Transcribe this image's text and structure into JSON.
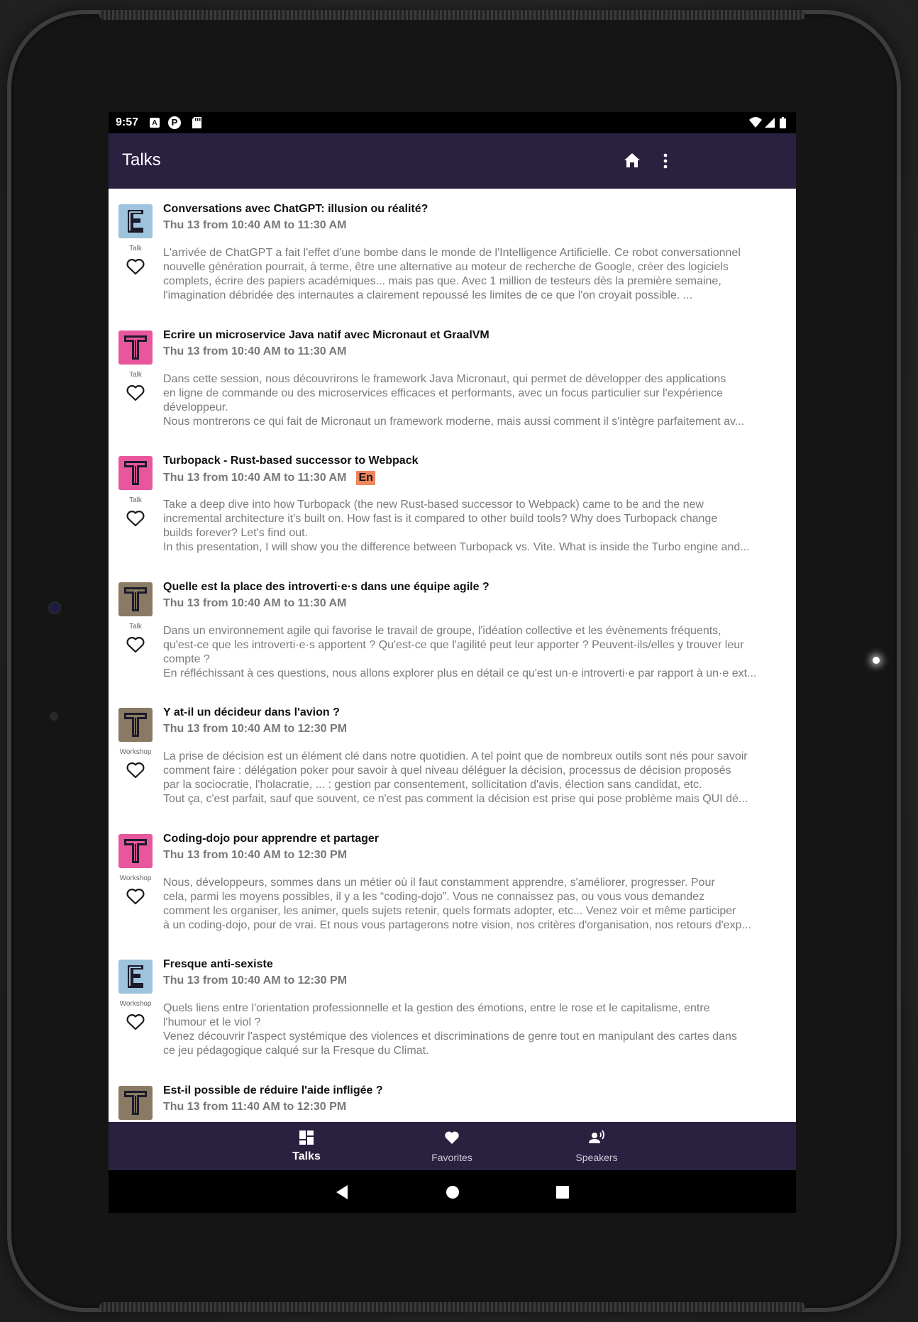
{
  "status_bar": {
    "time": "9:57",
    "a_icon": "A",
    "p_icon": "P"
  },
  "app_bar": {
    "title": "Talks"
  },
  "talks": [
    {
      "title": "Conversations avec ChatGPT: illusion ou réalité?",
      "time": "Thu 13 from 10:40 AM to 11:30 AM",
      "type": "Talk",
      "badge": "",
      "logo": "E",
      "logo_color": "#9ec3dc",
      "desc": [
        "L'arrivée de ChatGPT a fait l'effet d'une bombe dans le monde de l'Intelligence Artificielle. Ce robot conversationnel",
        "nouvelle génération pourrait, à terme, être une alternative au moteur de recherche de Google, créer des logiciels",
        "complets,  écrire des papiers académiques... mais pas que. Avec 1 million de testeurs dès la première semaine,",
        "l'imagination débridée des internautes a clairement repoussé les limites de ce que l'on croyait possible. ..."
      ]
    },
    {
      "title": "Ecrire un microservice Java natif avec Micronaut et GraalVM",
      "time": "Thu 13 from 10:40 AM to 11:30 AM",
      "type": "Talk",
      "badge": "",
      "logo": "T",
      "logo_color": "#e8569e",
      "desc": [
        "Dans cette session, nous découvrirons le framework Java Micronaut, qui permet de développer des applications",
        "en ligne de commande ou des microservices efficaces et performants, avec un focus particulier sur l'expérience",
        "développeur.",
        "Nous montrerons ce qui fait de Micronaut un framework moderne, mais aussi comment il s'intègre parfaitement av..."
      ]
    },
    {
      "title": "Turbopack - Rust-based successor to Webpack",
      "time": "Thu 13 from 10:40 AM to 11:30 AM",
      "type": "Talk",
      "badge": "En",
      "logo": "T",
      "logo_color": "#e8569e",
      "desc": [
        "Take a deep dive into how Turbopack (the new Rust-based successor to Webpack) came to be and the new",
        "incremental architecture it's built on. How fast is it compared to other build tools? Why does Turbopack change",
        "builds forever? Let's find out.",
        "In this presentation, I will show you the difference between Turbopack vs. Vite. What is inside the Turbo engine and..."
      ]
    },
    {
      "title": "Quelle est la place des introverti·e·s dans une équipe agile ?",
      "time": "Thu 13 from 10:40 AM to 11:30 AM",
      "type": "Talk",
      "badge": "",
      "logo": "T",
      "logo_color": "#8a7a64",
      "desc": [
        "Dans un environnement agile qui favorise le travail de groupe, l'idéation collective et les évènements fréquents,",
        "qu'est-ce que les introverti·e·s apportent ? Qu'est-ce que l'agilité peut leur apporter ? Peuvent-ils/elles y trouver leur",
        "compte ?",
        "En réfléchissant à ces questions, nous allons explorer plus en détail ce qu'est un·e introverti·e par rapport à un·e ext..."
      ]
    },
    {
      "title": "Y at-il un décideur dans l'avion ?",
      "time": "Thu 13 from 10:40 AM to 12:30 PM",
      "type": "Workshop",
      "badge": "",
      "logo": "T",
      "logo_color": "#8a7a64",
      "desc": [
        "La prise de décision est un élément clé dans notre quotidien. A tel point que de nombreux outils sont nés pour savoir",
        "comment faire : délégation poker pour savoir à quel niveau déléguer la décision, processus de décision proposés",
        "par la sociocratie, l'holacratie, ... : gestion par consentement, sollicitation d'avis, élection sans candidat, etc.",
        "Tout ça, c'est parfait, sauf que souvent, ce n'est pas comment la décision est prise qui pose problème mais QUI dé..."
      ]
    },
    {
      "title": "Coding-dojo pour apprendre et partager",
      "time": "Thu 13 from 10:40 AM to 12:30 PM",
      "type": "Workshop",
      "badge": "",
      "logo": "T",
      "logo_color": "#e8569e",
      "desc": [
        "Nous, développeurs, sommes dans un métier où il faut constamment apprendre, s'améliorer, progresser. Pour",
        "cela, parmi les moyens possibles, il y a les “coding-dojo”. Vous ne connaissez pas, ou vous vous demandez",
        "comment les organiser, les animer, quels sujets retenir, quels formats adopter, etc... Venez voir et même participer",
        "à un coding-dojo, pour de vrai. Et nous vous partagerons notre vision, nos critères d'organisation, nos retours d'exp..."
      ]
    },
    {
      "title": "Fresque anti-sexiste",
      "time": "Thu 13 from 10:40 AM to 12:30 PM",
      "type": "Workshop",
      "badge": "",
      "logo": "E",
      "logo_color": "#9ec3dc",
      "desc": [
        "Quels liens entre l'orientation professionnelle et la gestion des émotions, entre le rose et le capitalisme, entre",
        "l'humour et le viol ?",
        "Venez découvrir l'aspect systémique des violences et discriminations de genre tout en manipulant des cartes dans",
        "ce jeu pédagogique calqué sur la Fresque du Climat."
      ]
    },
    {
      "title": "Est-il possible de réduire l'aide infligée ?",
      "time": "Thu 13 from 11:40 AM to 12:30 PM",
      "type": "",
      "badge": "",
      "logo": "T",
      "logo_color": "#8a7a64",
      "desc": []
    }
  ],
  "bottom_nav": [
    {
      "label": "Talks",
      "icon": "dashboard-icon",
      "active": true
    },
    {
      "label": "Favorites",
      "icon": "heart-icon",
      "active": false
    },
    {
      "label": "Speakers",
      "icon": "speaker-icon",
      "active": false
    }
  ],
  "colors": {
    "primary": "#2a2140",
    "badge_en": "#f0865c"
  }
}
